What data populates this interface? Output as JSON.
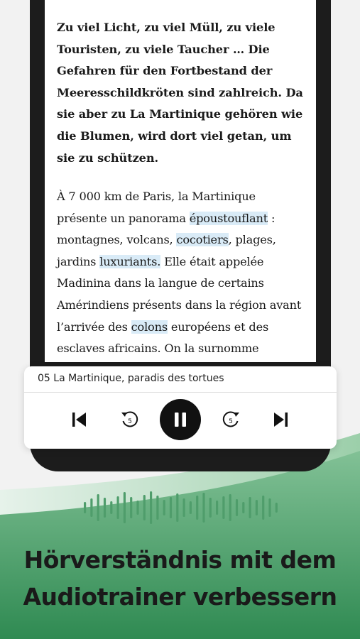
{
  "text_de": "Zu viel Licht, zu viel Müll, zu viele Touristen, zu viele Taucher … Die Gefahren für den Fortbestand der Meeresschildkröten sind zahlreich. Da sie aber zu La Martinique gehören wie die Blumen, wird dort viel getan, um sie zu schützen.",
  "text_fr": {
    "s1": "À 7 000 km de Paris, la Martinique présente un panorama ",
    "w1": "époustouflant",
    "s2": " : montagnes, volcans, ",
    "w2": "cocotiers",
    "s3": ", plages, jardins ",
    "w3": "luxuriants.",
    "s4": " Elle était appelée Madinina dans la langue de certains Amérindiens présents dans la région avant l’arrivée des ",
    "w4": "colons",
    "s5": " européens et des esclaves africains. On la surnomme"
  },
  "player": {
    "track_title": "05 La Martinique, paradis des tortues",
    "skip_seconds": "5",
    "controls": {
      "previous": "skip-previous-icon",
      "rewind": "rewind-5-icon",
      "pause": "pause-icon",
      "forward": "forward-5-icon",
      "next": "skip-next-icon"
    }
  },
  "headline": {
    "line1": "Hörverständnis mit dem",
    "line2": "Audiotrainer verbessern"
  },
  "colors": {
    "accent_green": "#3d8f5a",
    "highlight": "#d9ebf7",
    "phone": "#1c1c1c"
  }
}
